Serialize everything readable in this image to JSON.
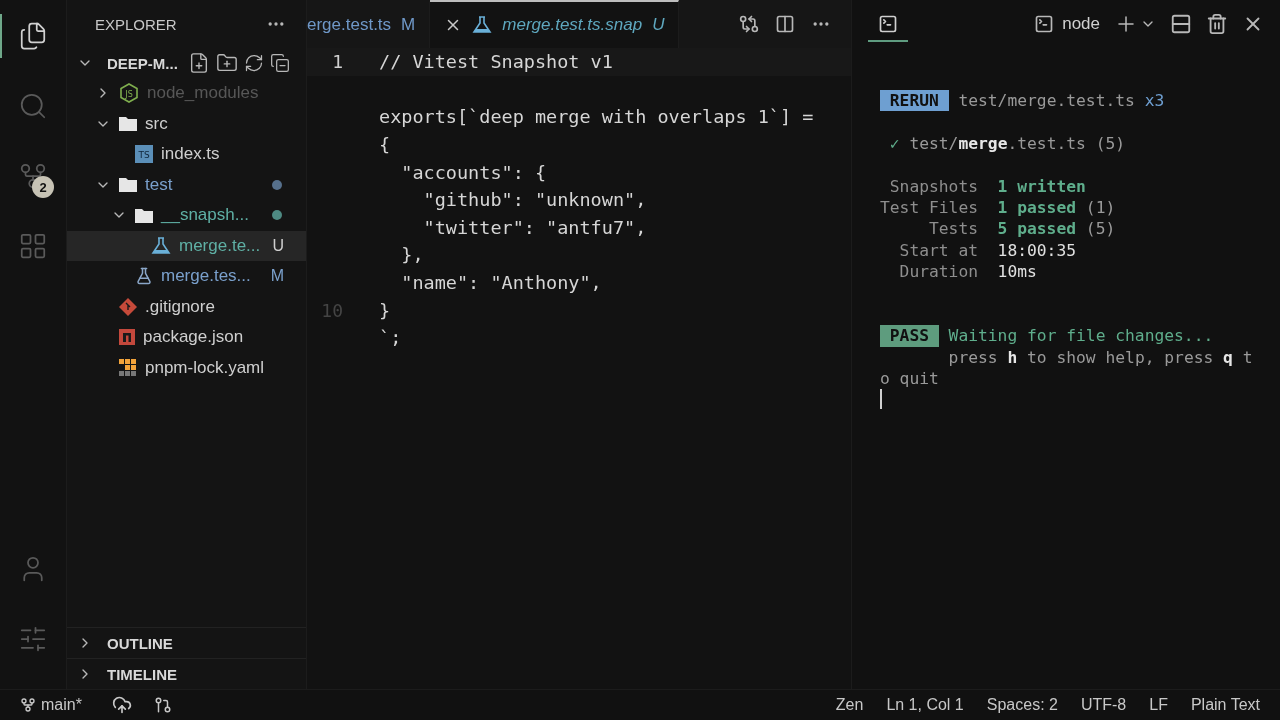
{
  "activity_bar": {
    "items": [
      {
        "kind": "explorer",
        "selected": true
      },
      {
        "kind": "search",
        "selected": false
      },
      {
        "kind": "source-control",
        "selected": false,
        "badge": "2"
      },
      {
        "kind": "extensions",
        "selected": false
      }
    ],
    "bottom": [
      {
        "kind": "account"
      },
      {
        "kind": "manage"
      }
    ]
  },
  "sidebar": {
    "title": "EXPLORER",
    "project": {
      "name": "DEEP-M...",
      "expanded": true
    },
    "tree": [
      {
        "name": "node_modules",
        "kind": "node",
        "icon_text": "JS",
        "ignored": true,
        "modified": false,
        "untracked": false,
        "expanded": false,
        "selected": false
      },
      {
        "name": "src",
        "kind": "folder",
        "ignored": false,
        "modified": false,
        "untracked": false,
        "expanded": true,
        "selected": false,
        "children": [
          {
            "name": "index.ts",
            "kind": "typescript",
            "icon_text": "TS",
            "ignored": false,
            "modified": false,
            "untracked": false,
            "selected": false
          }
        ]
      },
      {
        "name": "test",
        "kind": "folder",
        "ignored": false,
        "modified": true,
        "untracked": false,
        "color": "#56708c",
        "expanded": true,
        "selected": false,
        "children": [
          {
            "name": "__snapsh...",
            "kind": "folder",
            "ignored": false,
            "modified": false,
            "untracked": true,
            "color": "#4e8a83",
            "expanded": true,
            "selected": false,
            "children": [
              {
                "name": "merge.te...",
                "kind": "snapshot",
                "ignored": false,
                "modified": false,
                "untracked": true,
                "status": "U",
                "selected": true
              }
            ]
          },
          {
            "name": "merge.tes...",
            "kind": "test",
            "ignored": false,
            "modified": true,
            "untracked": false,
            "status": "M",
            "selected": false
          }
        ]
      },
      {
        "name": ".gitignore",
        "kind": "git",
        "ignored": false,
        "modified": false,
        "untracked": false,
        "selected": false
      },
      {
        "name": "package.json",
        "kind": "npm",
        "ignored": false,
        "modified": false,
        "untracked": false,
        "selected": false
      },
      {
        "name": "pnpm-lock.yaml",
        "kind": "pnpm",
        "ignored": false,
        "modified": false,
        "untracked": false,
        "selected": false
      }
    ],
    "sections": [
      {
        "title": "OUTLINE",
        "expanded": false
      },
      {
        "title": "TIMELINE",
        "expanded": false
      }
    ]
  },
  "editor": {
    "tabs": [
      {
        "label": "erge.test.ts",
        "status": "M",
        "selected": false
      },
      {
        "label": "merge.test.ts.snap",
        "status": "U",
        "selected": true
      }
    ],
    "lines": [
      {
        "kind": "code",
        "number": "1",
        "text": "// Vitest Snapshot v1",
        "current": true
      },
      {
        "kind": "blank"
      },
      {
        "kind": "code",
        "text": "exports[`deep merge with overlaps 1`] ="
      },
      {
        "kind": "code",
        "text": "{"
      },
      {
        "kind": "code",
        "text": "  \"accounts\": {"
      },
      {
        "kind": "code",
        "text": "    \"github\": \"unknown\","
      },
      {
        "kind": "code",
        "text": "    \"twitter\": \"antfu7\","
      },
      {
        "kind": "code",
        "text": "  },"
      },
      {
        "kind": "code",
        "text": "  \"name\": \"Anthony\","
      },
      {
        "kind": "code",
        "number": "10",
        "text": "}",
        "current": false
      },
      {
        "kind": "code",
        "text": "`;"
      }
    ]
  },
  "terminal": {
    "view_selected": true,
    "shell": "node",
    "output": [
      {
        "kind": "badge",
        "badge": "RERUN",
        "color": "#6e9fd1",
        "text": "test/merge.test.ts",
        "extra": "x3",
        "highlight": false
      },
      {
        "kind": "blank"
      },
      {
        "kind": "result",
        "mark": "✓",
        "text": "test/**merge**.test.ts (5)"
      },
      {
        "kind": "blank"
      },
      {
        "kind": "stat",
        "label": "Snapshots",
        "value": "1 written",
        "highlight": true
      },
      {
        "kind": "stat",
        "label": "Test Files",
        "value": "1 passed",
        "extra": "(1)",
        "highlight": true
      },
      {
        "kind": "stat",
        "label": "Tests",
        "value": "5 passed",
        "extra": "(5)",
        "highlight": true
      },
      {
        "kind": "stat",
        "label": "Start at",
        "value": "18:00:35",
        "highlight": false
      },
      {
        "kind": "stat",
        "label": "Duration",
        "value": "10ms",
        "highlight": false
      },
      {
        "kind": "blank"
      },
      {
        "kind": "blank"
      },
      {
        "kind": "badge",
        "badge": "PASS",
        "color": "#5e9c7e",
        "text": "Waiting for file changes...",
        "highlight": true
      },
      {
        "kind": "hint",
        "text": "press **h** to show help, press **q** t"
      },
      {
        "kind": "wrap",
        "text": "o quit"
      },
      {
        "kind": "cursor"
      }
    ]
  },
  "status_bar": {
    "branch": "main*",
    "items": [
      "Zen",
      "Ln 1, Col 1",
      "Spaces: 2",
      "UTF-8",
      "LF",
      "Plain Text"
    ]
  }
}
